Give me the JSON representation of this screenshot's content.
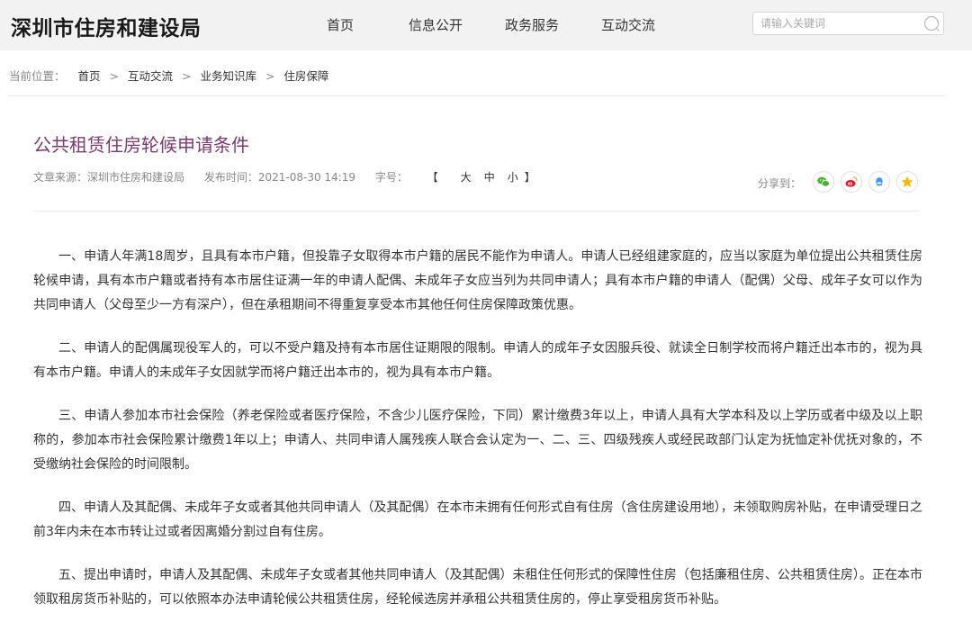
{
  "header": {
    "site_title": "深圳市住房和建设局",
    "nav": [
      "首页",
      "信息公开",
      "政务服务",
      "互动交流"
    ],
    "search_placeholder": "请输入关键词"
  },
  "breadcrumb": {
    "prefix": "当前位置：",
    "items": [
      "首页",
      "互动交流",
      "业务知识库",
      "住房保障"
    ],
    "separator": ">"
  },
  "article": {
    "title": "公共租赁住房轮候申请条件",
    "source_label": "文章来源：深圳市住房和建设局",
    "date_label": "发布时间：2021-08-30 14:19",
    "fontsize_label": "字号：",
    "fontsize_open": "【",
    "fontsize_options": [
      "大",
      "中",
      "小"
    ],
    "fontsize_close": "】",
    "share_label": "分享到：",
    "paragraphs": [
      "一、申请人年满18周岁，且具有本市户籍，但投靠子女取得本市户籍的居民不能作为申请人。申请人已经组建家庭的，应当以家庭为单位提出公共租赁住房轮候申请，具有本市户籍或者持有本市居住证满一年的申请人配偶、未成年子女应当列为共同申请人；具有本市户籍的申请人（配偶）父母、成年子女可以作为共同申请人（父母至少一方有深户），但在承租期间不得重复享受本市其他任何住房保障政策优惠。",
      "二、申请人的配偶属现役军人的，可以不受户籍及持有本市居住证期限的限制。申请人的成年子女因服兵役、就读全日制学校而将户籍迁出本市的，视为具有本市户籍。申请人的未成年子女因就学而将户籍迁出本市的，视为具有本市户籍。",
      "三、申请人参加本市社会保险（养老保险或者医疗保险，不含少儿医疗保险，下同）累计缴费3年以上，申请人具有大学本科及以上学历或者中级及以上职称的，参加本市社会保险累计缴费1年以上；申请人、共同申请人属残疾人联合会认定为一、二、三、四级残疾人或经民政部门认定为抚恤定补优抚对象的，不受缴纳社会保险的时间限制。",
      "四、申请人及其配偶、未成年子女或者其他共同申请人（及其配偶）在本市未拥有任何形式自有住房（含住房建设用地），未领取购房补贴，在申请受理日之前3年内未在本市转让过或者因离婚分割过自有住房。",
      "五、提出申请时，申请人及其配偶、未成年子女或者其他共同申请人（及其配偶）未租住任何形式的保障性住房（包括廉租住房、公共租赁住房）。正在本市领取租房货币补贴的，可以依照本办法申请轮候公共租赁住房，经轮候选房并承租公共租赁住房的，停止享受租房货币补贴。"
    ]
  },
  "share_icons": [
    "wechat-icon",
    "weibo-icon",
    "qq-icon",
    "qzone-icon"
  ],
  "colors": {
    "title": "#7a3b6e",
    "header_bg": "#f2f2f2",
    "wechat": "#49b233",
    "weibo": "#e6162d",
    "qq": "#3c9bf0",
    "qzone": "#f5b800"
  }
}
